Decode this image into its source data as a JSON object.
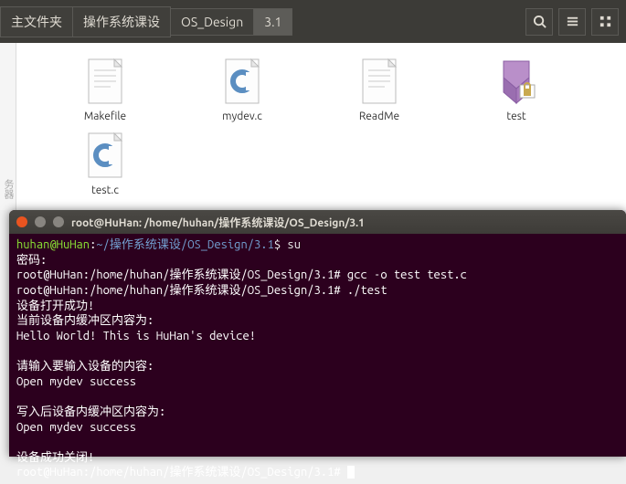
{
  "fm": {
    "crumbs": [
      "主文件夹",
      "操作系统课设",
      "OS_Design",
      "3.1"
    ],
    "active_crumb": 3,
    "sidebar_hint": "务器",
    "files": [
      {
        "name": "Makefile",
        "icon": "text"
      },
      {
        "name": "mydev.c",
        "icon": "c"
      },
      {
        "name": "ReadMe",
        "icon": "text"
      },
      {
        "name": "test",
        "icon": "lock"
      },
      {
        "name": "test.c",
        "icon": "c"
      }
    ],
    "toolbar": {
      "search": "search",
      "list": "list",
      "grid": "grid"
    }
  },
  "terminal": {
    "title": "root@HuHan: /home/huhan/操作系统课设/OS_Design/3.1",
    "prompt1_user": "huhan@HuHan",
    "prompt1_path": "~/操作系统课设/OS_Design/3.1",
    "prompt1_cmd": "su",
    "line_pw": "密码:",
    "line_root1": "root@HuHan:/home/huhan/操作系统课设/OS_Design/3.1# gcc -o test test.c",
    "line_root2": "root@HuHan:/home/huhan/操作系统课设/OS_Design/3.1# ./test",
    "line_open_ok": "设备打开成功!",
    "line_cur_buf": "当前设备内缓冲区内容为:",
    "line_hello": "Hello World! This is HuHan's device!",
    "line_please": "请输入要输入设备的内容:",
    "line_open1": "Open mydev success",
    "line_after": "写入后设备内缓冲区内容为:",
    "line_open2": "Open mydev success",
    "line_closed": "设备成功关闭!",
    "line_root3": "root@HuHan:/home/huhan/操作系统课设/OS_Design/3.1# "
  }
}
